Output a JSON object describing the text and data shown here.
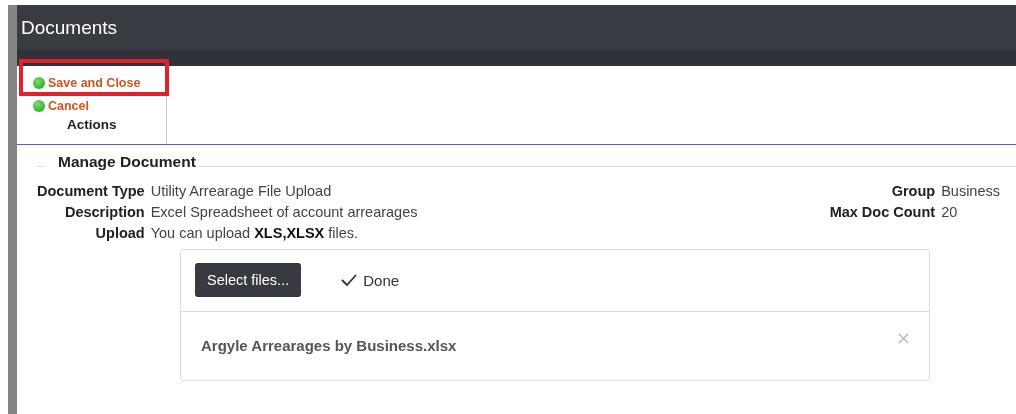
{
  "window": {
    "title": "Documents"
  },
  "toolbar": {
    "group_label": "Actions",
    "actions": [
      {
        "label": "Save and Close",
        "highlighted": true
      },
      {
        "label": "Cancel",
        "highlighted": false
      }
    ]
  },
  "section": {
    "title": "Manage Document",
    "left_fields": [
      {
        "label": "Document Type",
        "value": "Utility Arrearage File Upload"
      },
      {
        "label": "Description",
        "value": "Excel Spreadsheet of account arrearages"
      },
      {
        "label": "Upload",
        "value": "You can upload **XLS,XLSX** files."
      }
    ],
    "right_fields": [
      {
        "label": "Group",
        "value": "Business"
      },
      {
        "label": "Max Doc Count",
        "value": "20"
      }
    ]
  },
  "uploader": {
    "button": "Select files...",
    "status": "Done",
    "files": [
      {
        "name": "Argyle Arrearages by Business.xlsx"
      }
    ]
  }
}
